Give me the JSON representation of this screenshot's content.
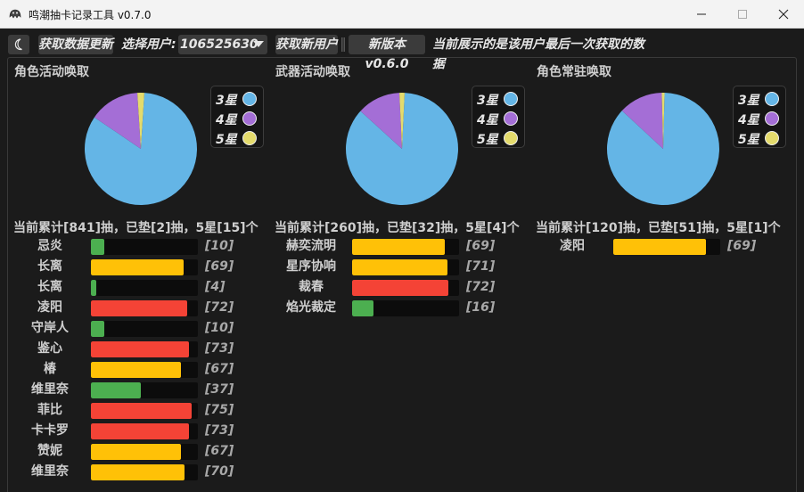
{
  "window": {
    "title": "鸣潮抽卡记录工具 v0.7.0"
  },
  "toolbar": {
    "fetch_label": "获取数据更新",
    "select_user_label": "选择用户:",
    "selected_user": "106525630",
    "new_user_label": "获取新用户",
    "version_label": "新版本 v0.6.0",
    "status_text": "当前展示的是该用户最后一次获取的数据"
  },
  "colors": {
    "three_star": "#64b5e6",
    "four_star": "#a46ed6",
    "five_star": "#e4db6c",
    "bar_green": "#4caf50",
    "bar_yellow": "#ffc107",
    "bar_red": "#f44336"
  },
  "legend": [
    "3星",
    "4星",
    "5星"
  ],
  "bar_max": 80,
  "panels": [
    {
      "title": "角色活动唤取",
      "summary": "当前累计[841]抽，已垫[2]抽，5星[15]个",
      "pie": {
        "three_star": 0.835,
        "four_star": 0.145,
        "five_star": 0.02
      },
      "rows": [
        {
          "name": "忌炎",
          "value": 10,
          "color": "green"
        },
        {
          "name": "长离",
          "value": 69,
          "color": "yellow"
        },
        {
          "name": "长离",
          "value": 4,
          "color": "green"
        },
        {
          "name": "凌阳",
          "value": 72,
          "color": "red"
        },
        {
          "name": "守岸人",
          "value": 10,
          "color": "green"
        },
        {
          "name": "鉴心",
          "value": 73,
          "color": "red"
        },
        {
          "name": "椿",
          "value": 67,
          "color": "yellow"
        },
        {
          "name": "维里奈",
          "value": 37,
          "color": "green"
        },
        {
          "name": "菲比",
          "value": 75,
          "color": "red"
        },
        {
          "name": "卡卡罗",
          "value": 73,
          "color": "red"
        },
        {
          "name": "赞妮",
          "value": 67,
          "color": "yellow"
        },
        {
          "name": "维里奈",
          "value": 70,
          "color": "yellow"
        }
      ]
    },
    {
      "title": "武器活动唤取",
      "summary": "当前累计[260]抽，已垫[32]抽，5星[4]个",
      "pie": {
        "three_star": 0.86,
        "four_star": 0.125,
        "five_star": 0.015
      },
      "rows": [
        {
          "name": "赫奕流明",
          "value": 69,
          "color": "yellow"
        },
        {
          "name": "星序协响",
          "value": 71,
          "color": "yellow"
        },
        {
          "name": "裁春",
          "value": 72,
          "color": "red"
        },
        {
          "name": "焰光裁定",
          "value": 16,
          "color": "green"
        }
      ]
    },
    {
      "title": "角色常驻唤取",
      "summary": "当前累计[120]抽，已垫[51]抽，5星[1]个",
      "pie": {
        "three_star": 0.865,
        "four_star": 0.127,
        "five_star": 0.008
      },
      "rows": [
        {
          "name": "凌阳",
          "value": 69,
          "color": "yellow"
        }
      ]
    }
  ]
}
